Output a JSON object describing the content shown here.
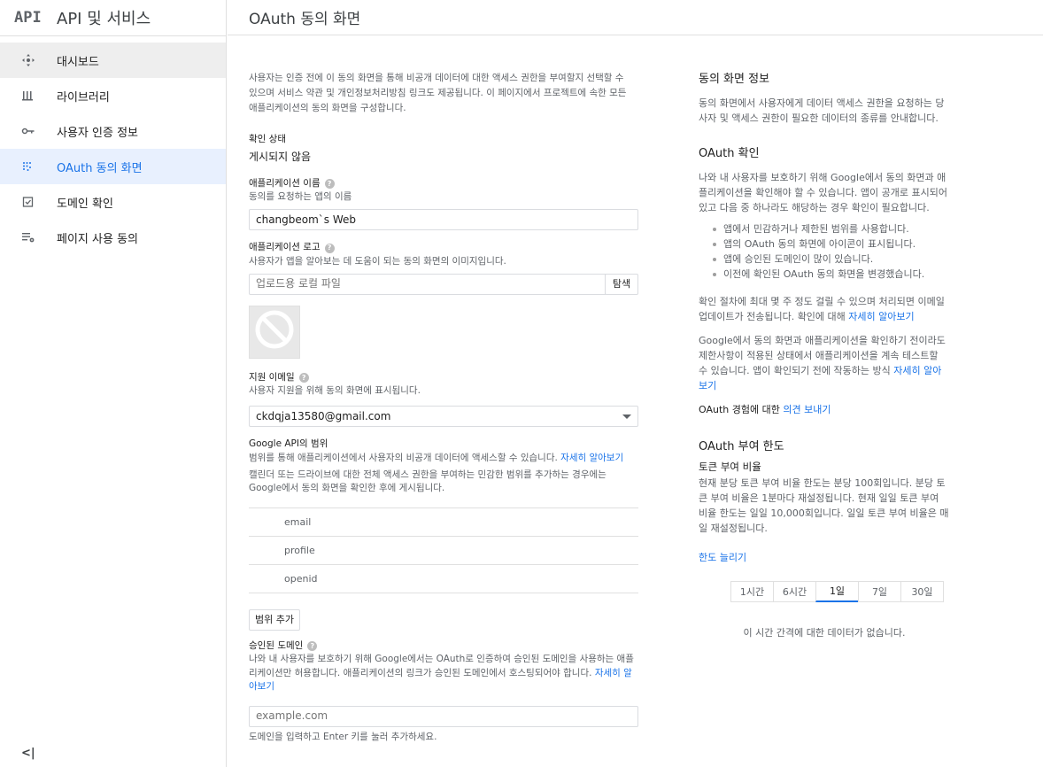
{
  "sidebar": {
    "logo": "API",
    "title": "API 및 서비스",
    "items": [
      {
        "label": "대시보드"
      },
      {
        "label": "라이브러리"
      },
      {
        "label": "사용자 인증 정보"
      },
      {
        "label": "OAuth 동의 화면"
      },
      {
        "label": "도메인 확인"
      },
      {
        "label": "페이지 사용 동의"
      }
    ],
    "collapse": "<|"
  },
  "header": {
    "title": "OAuth 동의 화면"
  },
  "form": {
    "intro": "사용자는 인증 전에 이 동의 화면을 통해 비공개 데이터에 대한 액세스 권한을 부여할지 선택할 수 있으며 서비스 약관 및 개인정보처리방침 링크도 제공됩니다. 이 페이지에서 프로젝트에 속한 모든 애플리케이션의 동의 화면을 구성합니다.",
    "status_label": "확인 상태",
    "status_value": "게시되지 않음",
    "app_name_label": "애플리케이션 이름",
    "app_name_desc": "동의를 요청하는 앱의 이름",
    "app_name_value": "changbeom`s Web",
    "app_logo_label": "애플리케이션 로고",
    "app_logo_desc": "사용자가 앱을 알아보는 데 도움이 되는 동의 화면의 이미지입니다.",
    "file_placeholder": "업로드용 로컬 파일",
    "browse_label": "탐색",
    "email_label": "지원 이메일",
    "email_desc": "사용자 지원을 위해 동의 화면에 표시됩니다.",
    "email_value": "ckdqja13580@gmail.com",
    "scopes_label": "Google API의 범위",
    "scopes_desc": "범위를 통해 애플리케이션에서 사용자의 비공개 데이터에 액세스할 수 있습니다.",
    "scopes_link": "자세히 알아보기",
    "scopes_note": "캘린더 또는 드라이브에 대한 전체 액세스 권한을 부여하는 민감한 범위를 추가하는 경우에는 Google에서 동의 화면을 확인한 후에 게시됩니다.",
    "scopes": [
      "email",
      "profile",
      "openid"
    ],
    "add_scope_label": "범위 추가",
    "domains_label": "승인된 도메인",
    "domains_desc": "나와 내 사용자를 보호하기 위해 Google에서는 OAuth로 인증하여 승인된 도메인을 사용하는 애플리케이션만 허용합니다. 애플리케이션의 링크가 승인된 도메인에서 호스팅되어야 합니다.",
    "domains_link": "자세히 알아보기",
    "domain_placeholder": "example.com",
    "domain_hint": "도메인을 입력하고 Enter 키를 눌러 추가하세요."
  },
  "info": {
    "consent_title": "동의 화면 정보",
    "consent_text": "동의 화면에서 사용자에게 데이터 액세스 권한을 요청하는 당사자 및 액세스 권한이 필요한 데이터의 종류를 안내합니다.",
    "verify_title": "OAuth 확인",
    "verify_text": "나와 내 사용자를 보호하기 위해 Google에서 동의 화면과 애플리케이션을 확인해야 할 수 있습니다. 앱이 공개로 표시되어 있고 다음 중 하나라도 해당하는 경우 확인이 필요합니다.",
    "bullets": [
      "앱에서 민감하거나 제한된 범위를 사용합니다.",
      "앱의 OAuth 동의 화면에 아이콘이 표시됩니다.",
      "앱에 승인된 도메인이 많이 있습니다.",
      "이전에 확인된 OAuth 동의 화면을 변경했습니다."
    ],
    "verify_time": "확인 절차에 최대 몇 주 정도 걸릴 수 있으며 처리되면 이메일 업데이트가 전송됩니다. 확인에 대해",
    "verify_time_link": "자세히 알아보기",
    "test_text": "Google에서 동의 화면과 애플리케이션을 확인하기 전이라도 제한사항이 적용된 상태에서 애플리케이션을 계속 테스트할 수 있습니다. 앱이 확인되기 전에 작동하는 방식",
    "test_link": "자세히 알아보기",
    "feedback_text": "OAuth 경험에 대한",
    "feedback_link": "의견 보내기",
    "quota_title": "OAuth 부여 한도",
    "rate_title": "토큰 부여 비율",
    "rate_text": "현재 분당 토큰 부여 비율 한도는 분당 100회입니다. 분당 토큰 부여 비율은 1분마다 재설정됩니다. 현재 일일 토큰 부여 비율 한도는 일일 10,000회입니다. 일일 토큰 부여 비율은 매일 재설정됩니다.",
    "increase_link": "한도 늘리기",
    "tabs": [
      "1시간",
      "6시간",
      "1일",
      "7일",
      "30일"
    ],
    "active_tab": "1일",
    "no_data": "이 시간 간격에 대한 데이터가 없습니다."
  }
}
